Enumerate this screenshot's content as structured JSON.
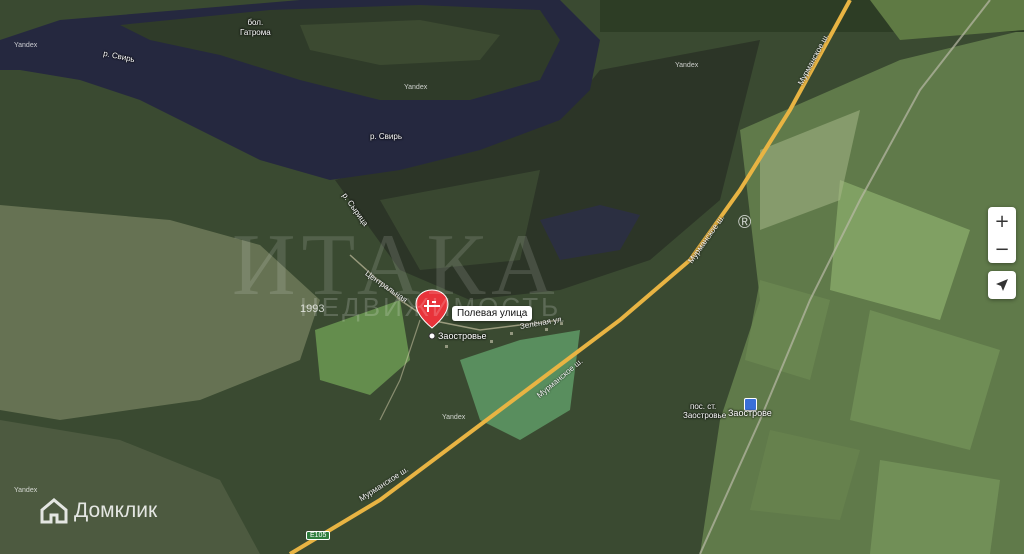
{
  "map": {
    "river_labels": [
      "р. Свирь",
      "р. Свирь",
      "р. Сырица"
    ],
    "lake_label": "бол.\nГатрома",
    "yandex_marks": [
      "Yandex",
      "Yandex",
      "Yandex",
      "Yandex",
      "Yandex"
    ],
    "road_labels": {
      "murmansk_1": "Мурманское ш.",
      "murmansk_2": "Мурманское ш.",
      "murmansk_3": "Мурманское ш.",
      "street_1": "Центральная",
      "street_2": "Зелёная ул."
    },
    "places": {
      "village": "Заостровье",
      "station_line1": "пос. ст.",
      "station_line2": "Заостровье",
      "station_name": "Заострове"
    },
    "pin_label": "Полевая улица",
    "highway_code": "E105",
    "watermark_year": "1993",
    "watermark_text": "ИТАКА",
    "watermark_sub": "НЕДВИЖИМОСТЬ",
    "watermark_reg": "®"
  },
  "controls": {
    "zoom_in": "+",
    "zoom_out": "−"
  },
  "brand": {
    "name": "Домклик"
  },
  "colors": {
    "water": "#25283f",
    "forest": "#2f4229",
    "field": "#7e9a62",
    "road": "#e8b443",
    "pin": "#e8333a"
  }
}
